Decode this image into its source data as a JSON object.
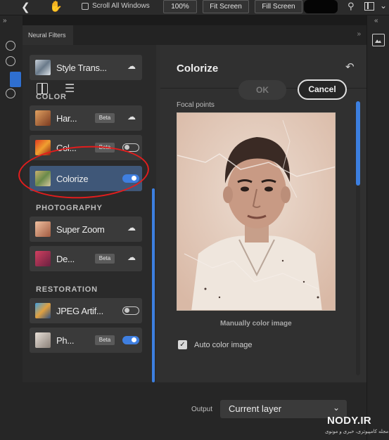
{
  "topbar": {
    "scroll_all_windows": "Scroll All Windows",
    "zoom_100": "100%",
    "fit_screen": "Fit Screen",
    "fill_screen": "Fill Screen"
  },
  "panel": {
    "tab_label": "Neural Filters"
  },
  "filters": {
    "items": [
      {
        "label": "Style Trans...",
        "status": "download"
      },
      {
        "label": "Har...",
        "badge": "Beta",
        "status": "download"
      },
      {
        "label": "Col...",
        "badge": "Beta",
        "status": "toggle-off"
      },
      {
        "label": "Colorize",
        "status": "toggle-on"
      },
      {
        "label": "Super Zoom",
        "status": "download"
      },
      {
        "label": "De...",
        "badge": "Beta",
        "status": "download"
      },
      {
        "label": "JPEG Artif...",
        "status": "toggle-off"
      },
      {
        "label": "Ph...",
        "badge": "Beta",
        "status": "toggle-on"
      }
    ],
    "sections": {
      "color": "COLOR",
      "photography": "PHOTOGRAPHY",
      "restoration": "RESTORATION"
    }
  },
  "detail": {
    "title": "Colorize",
    "focal_points": "Focal points",
    "manual_link": "Manually color image",
    "auto_color_label": "Auto color image",
    "auto_color_checked": true
  },
  "output": {
    "label": "Output",
    "value": "Current layer"
  },
  "actions": {
    "ok": "OK",
    "cancel": "Cancel"
  },
  "watermark": {
    "brand": "NODY.IR",
    "sub": "مجله کامپیوتری، خبری و مونوی"
  },
  "colors": {
    "accent": "#3f7fe0",
    "selected_item": "#3f5778",
    "annotation_circle": "#e21d1d"
  }
}
